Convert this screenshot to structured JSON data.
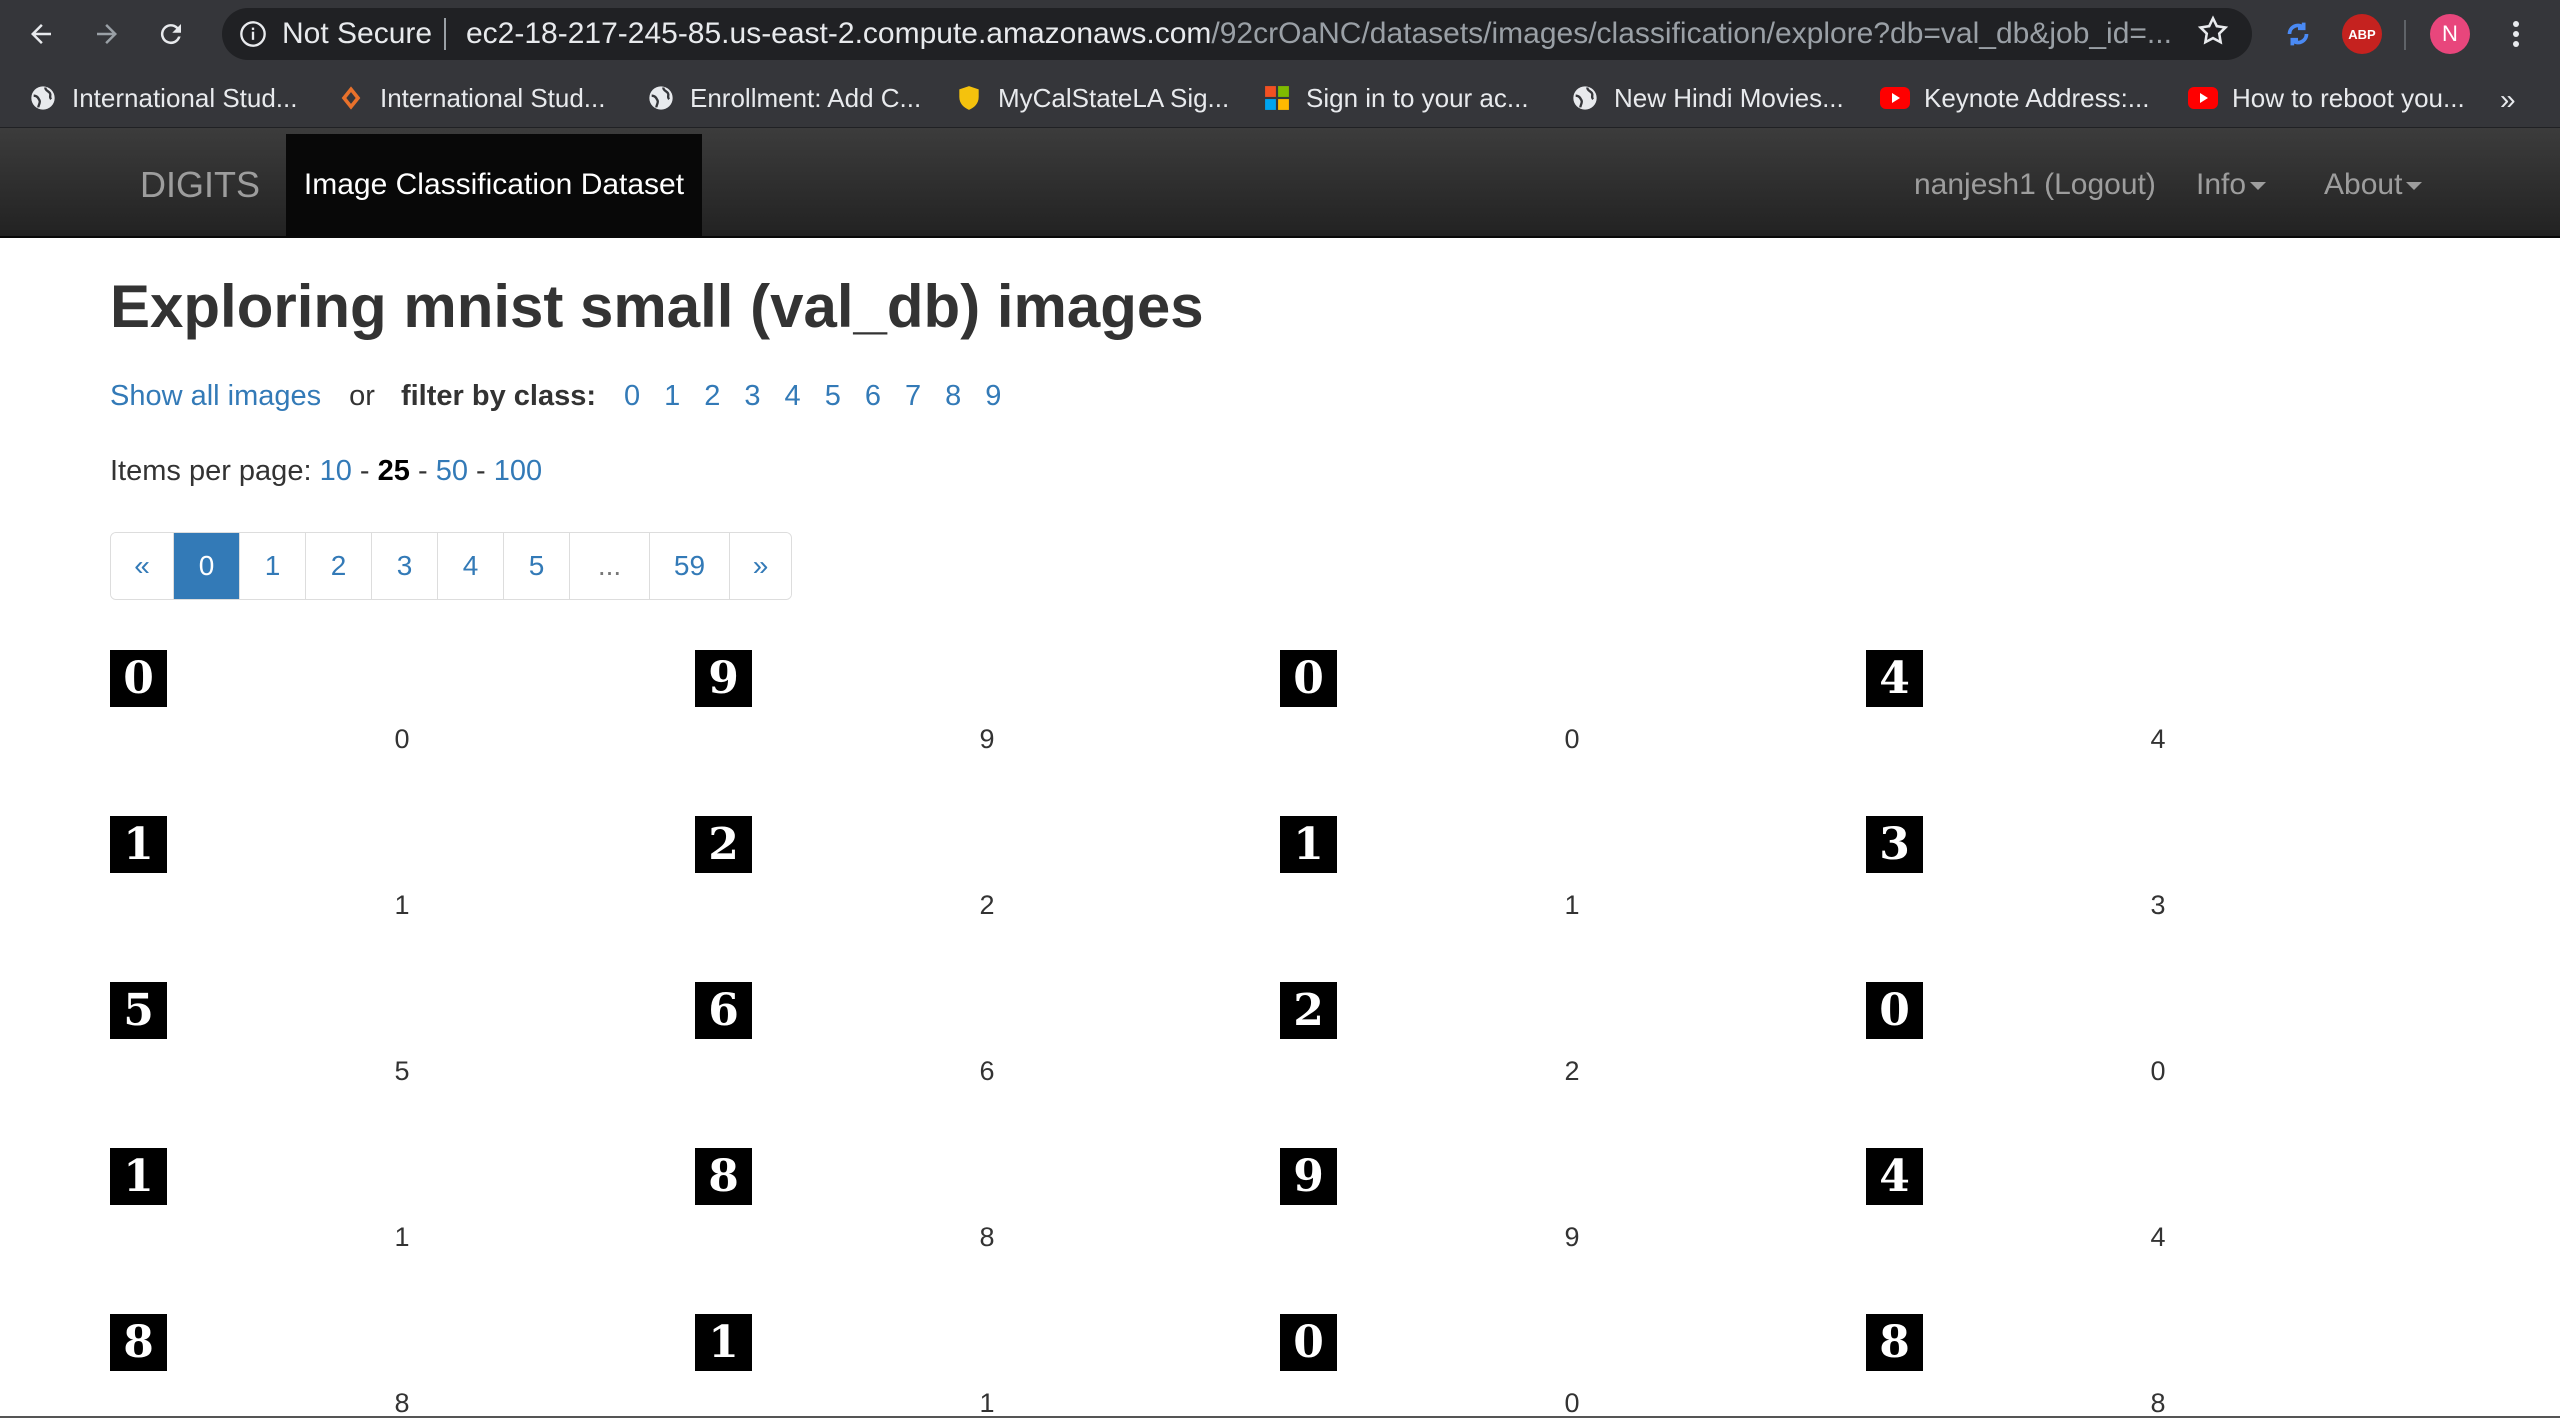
{
  "browser": {
    "security": "Not Secure",
    "url_host": "ec2-18-217-245-85.us-east-2.compute.amazonaws.com",
    "url_path": "/92crOaNC/datasets/images/classification/explore?db=val_db&job_id=...",
    "abp_label": "ABP",
    "profile_initial": "N",
    "more_label": "»",
    "bookmarks": [
      {
        "label": "International Stud...",
        "icon": "globe-icon"
      },
      {
        "label": "International Stud...",
        "icon": "diamond-icon"
      },
      {
        "label": "Enrollment: Add C...",
        "icon": "globe-icon"
      },
      {
        "label": "MyCalStateLA Sig...",
        "icon": "shield-icon"
      },
      {
        "label": "Sign in to your ac...",
        "icon": "microsoft-icon"
      },
      {
        "label": "New Hindi Movies...",
        "icon": "globe-icon"
      },
      {
        "label": "Keynote Address:...",
        "icon": "youtube-icon"
      },
      {
        "label": "How to reboot you...",
        "icon": "youtube-icon"
      }
    ]
  },
  "navbar": {
    "brand": "DIGITS",
    "active_tab": "Image Classification Dataset",
    "user": "nanjesh1 (Logout)",
    "info": "Info",
    "about": "About"
  },
  "page": {
    "title": "Exploring mnist small (val_db) images",
    "show_all": "Show all images",
    "or": "or",
    "filter_label": "filter by class:",
    "classes": [
      "0",
      "1",
      "2",
      "3",
      "4",
      "5",
      "6",
      "7",
      "8",
      "9"
    ],
    "per_page_label": "Items per page:",
    "per_page": [
      "10",
      "25",
      "50",
      "100"
    ],
    "per_page_selected": "25",
    "per_page_sep": "-",
    "pagination": [
      "«",
      "0",
      "1",
      "2",
      "3",
      "4",
      "5",
      "...",
      "59",
      "»"
    ],
    "pagination_active": "0"
  },
  "images": [
    {
      "glyph": "0",
      "label": "0"
    },
    {
      "glyph": "9",
      "label": "9"
    },
    {
      "glyph": "0",
      "label": "0"
    },
    {
      "glyph": "4",
      "label": "4"
    },
    {
      "glyph": "1",
      "label": "1"
    },
    {
      "glyph": "2",
      "label": "2"
    },
    {
      "glyph": "1",
      "label": "1"
    },
    {
      "glyph": "3",
      "label": "3"
    },
    {
      "glyph": "5",
      "label": "5"
    },
    {
      "glyph": "6",
      "label": "6"
    },
    {
      "glyph": "2",
      "label": "2"
    },
    {
      "glyph": "0",
      "label": "0"
    },
    {
      "glyph": "1",
      "label": "1"
    },
    {
      "glyph": "8",
      "label": "8"
    },
    {
      "glyph": "9",
      "label": "9"
    },
    {
      "glyph": "4",
      "label": "4"
    },
    {
      "glyph": "8",
      "label": "8"
    },
    {
      "glyph": "1",
      "label": "1"
    },
    {
      "glyph": "0",
      "label": "0"
    },
    {
      "glyph": "8",
      "label": "8"
    }
  ]
}
